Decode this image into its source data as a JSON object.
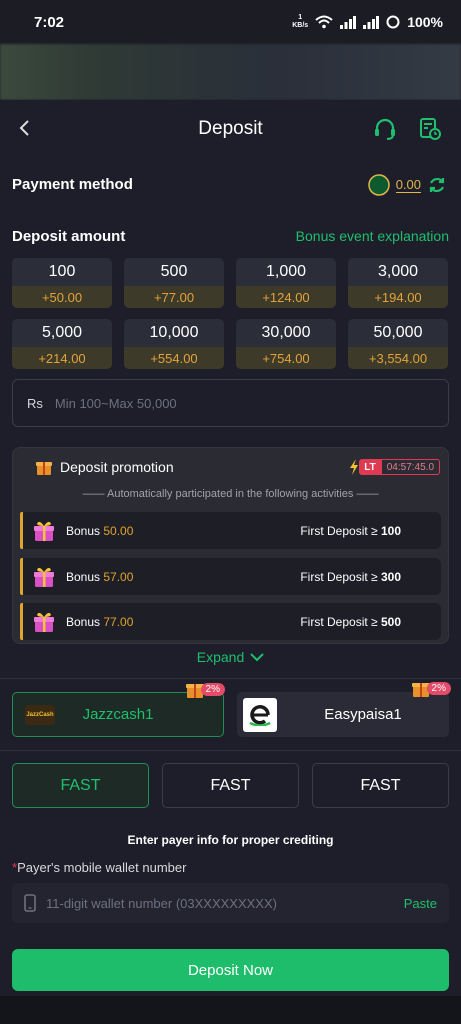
{
  "status_bar": {
    "time": "7:02",
    "net_speed": "1",
    "net_unit": "KB/s",
    "battery": "100%"
  },
  "header": {
    "title": "Deposit"
  },
  "payment": {
    "label": "Payment method",
    "balance": "0.00"
  },
  "deposit": {
    "label": "Deposit amount",
    "bonus_link": "Bonus event explanation",
    "amounts": [
      {
        "value": "100",
        "bonus": "+50.00"
      },
      {
        "value": "500",
        "bonus": "+77.00"
      },
      {
        "value": "1,000",
        "bonus": "+124.00"
      },
      {
        "value": "3,000",
        "bonus": "+194.00"
      },
      {
        "value": "5,000",
        "bonus": "+214.00"
      },
      {
        "value": "10,000",
        "bonus": "+554.00"
      },
      {
        "value": "30,000",
        "bonus": "+754.00"
      },
      {
        "value": "50,000",
        "bonus": "+3,554.00"
      }
    ],
    "currency": "Rs",
    "placeholder": "Min 100~Max 50,000"
  },
  "promotion": {
    "title": "Deposit promotion",
    "timer_tag": "LT",
    "timer": "04:57:45.0",
    "subtitle": "Automatically participated in the following activities",
    "rows": [
      {
        "label": "Bonus",
        "amount": "50.00",
        "condition": "First Deposit ≥",
        "threshold": "100"
      },
      {
        "label": "Bonus",
        "amount": "57.00",
        "condition": "First Deposit ≥",
        "threshold": "300"
      },
      {
        "label": "Bonus",
        "amount": "77.00",
        "condition": "First Deposit ≥",
        "threshold": "500"
      }
    ],
    "expand": "Expand"
  },
  "channels": [
    {
      "name": "Jazzcash1",
      "badge": "2%",
      "logo_text": "JazzCash"
    },
    {
      "name": "Easypaisa1",
      "badge": "2%"
    }
  ],
  "speeds": [
    "FAST",
    "FAST",
    "FAST"
  ],
  "payer": {
    "note": "Enter payer info for proper crediting",
    "star": "*",
    "label": "Payer's mobile wallet number",
    "placeholder": "11-digit wallet number (03XXXXXXXXX)",
    "paste": "Paste"
  },
  "cta": "Deposit Now",
  "colors": {
    "accent": "#1ebd6b",
    "bonus": "#e0a32e",
    "background": "#1d1e29"
  }
}
